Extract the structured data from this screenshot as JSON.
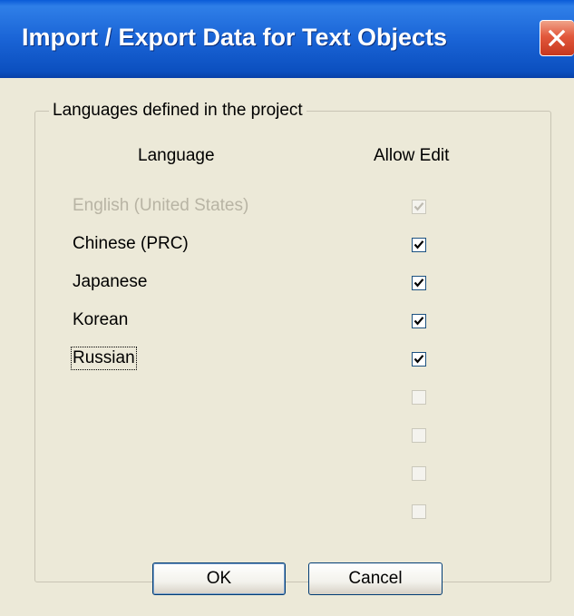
{
  "window": {
    "title": "Import / Export Data for Text Objects",
    "close_icon": "close-icon"
  },
  "group": {
    "label": "Languages defined in the project"
  },
  "table": {
    "columns": [
      "Language",
      "Allow Edit"
    ],
    "rows": [
      {
        "language": "English (United States)",
        "allow_edit": true,
        "enabled": false
      },
      {
        "language": "Chinese (PRC)",
        "allow_edit": true,
        "enabled": true
      },
      {
        "language": "Japanese",
        "allow_edit": true,
        "enabled": true
      },
      {
        "language": "Korean",
        "allow_edit": true,
        "enabled": true
      },
      {
        "language": "Russian",
        "allow_edit": true,
        "enabled": true,
        "focused": true
      },
      {
        "language": "",
        "allow_edit": false,
        "enabled": false
      },
      {
        "language": "",
        "allow_edit": false,
        "enabled": false
      },
      {
        "language": "",
        "allow_edit": false,
        "enabled": false
      },
      {
        "language": "",
        "allow_edit": false,
        "enabled": false
      }
    ]
  },
  "buttons": {
    "ok": "OK",
    "cancel": "Cancel"
  },
  "colors": {
    "title_bar": "#0a5bd8",
    "dialog_bg": "#ece9d8",
    "close_button": "#e2583c"
  }
}
